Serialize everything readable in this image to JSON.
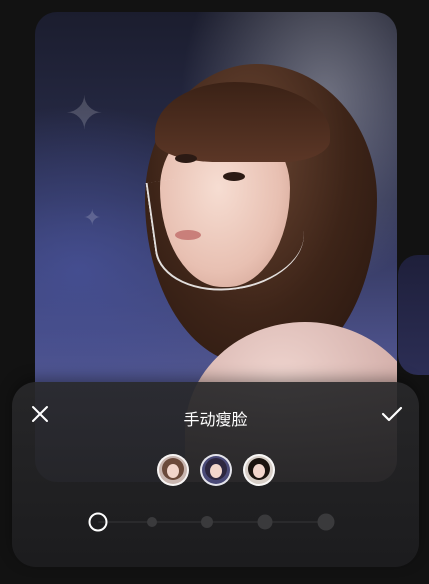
{
  "editor": {
    "title": "手动瘦脸",
    "close_icon": "close-icon",
    "confirm_icon": "checkmark-icon"
  },
  "face_thumbnails": [
    {
      "name": "face-1",
      "hair_color": "#6b4a3b",
      "selected": false
    },
    {
      "name": "face-2",
      "hair_color": "#2d2740",
      "selected": true
    },
    {
      "name": "face-3",
      "hair_color": "#1b140f",
      "selected": false
    }
  ],
  "intensity_slider": {
    "levels": 5,
    "current_level": 0
  },
  "colors": {
    "panel_bg": "#1c1c1e",
    "accent": "#ffffff",
    "track": "#3a3a3c"
  }
}
